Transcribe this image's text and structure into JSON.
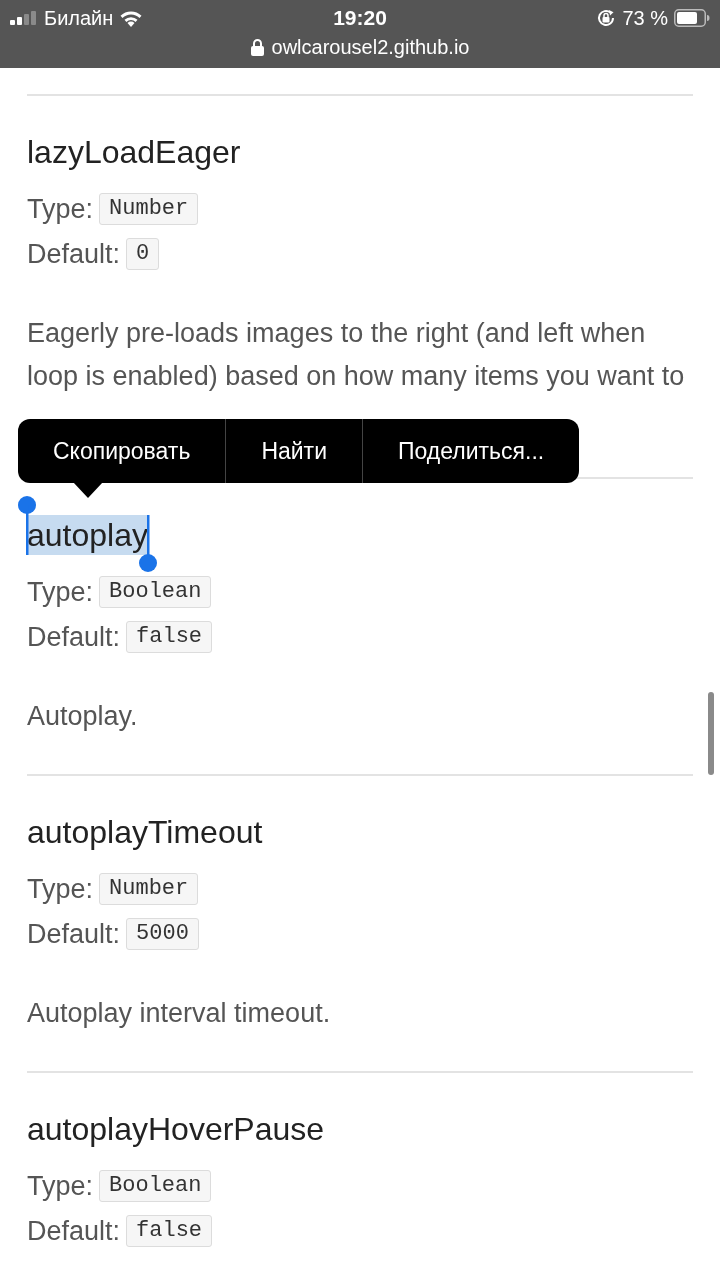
{
  "status_bar": {
    "carrier": "Билайн",
    "time": "19:20",
    "battery": "73 %"
  },
  "address_bar": {
    "url": "owlcarousel2.github.io"
  },
  "options": [
    {
      "name": "lazyLoadEager",
      "selected": false,
      "type_label": "Type:",
      "type": "Number",
      "default_label": "Default:",
      "default": "0",
      "description": "Eagerly pre-loads images to the right (and left when loop is enabled) based on how many items you want to"
    },
    {
      "name": "autoplay",
      "selected": true,
      "type_label": "Type:",
      "type": "Boolean",
      "default_label": "Default:",
      "default": "false",
      "description": "Autoplay."
    },
    {
      "name": "autoplayTimeout",
      "selected": false,
      "type_label": "Type:",
      "type": "Number",
      "default_label": "Default:",
      "default": "5000",
      "description": "Autoplay interval timeout."
    },
    {
      "name": "autoplayHoverPause",
      "selected": false,
      "type_label": "Type:",
      "type": "Boolean",
      "default_label": "Default:",
      "default": "false"
    }
  ],
  "context_menu": {
    "items": [
      "Скопировать",
      "Найти",
      "Поделиться..."
    ]
  }
}
